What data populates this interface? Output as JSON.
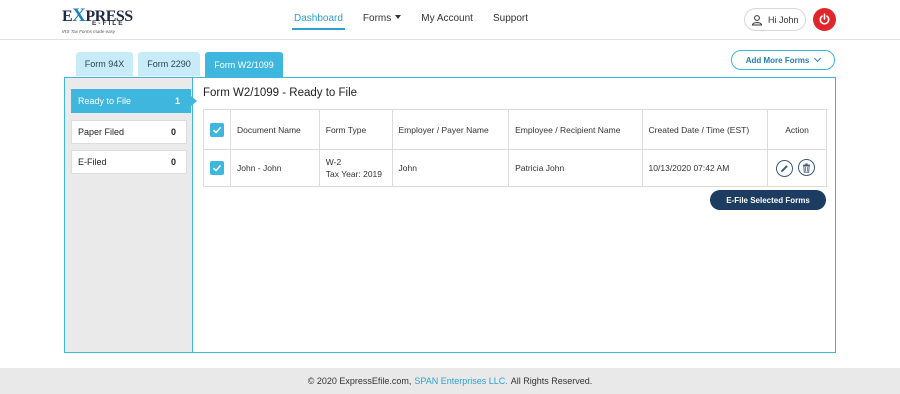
{
  "brand": {
    "logo_main_a": "E",
    "logo_main_x": "X",
    "logo_main_b": "PRESS",
    "logo_sub": "E-FILE",
    "logo_tag": "IRS Tax Forms made easy"
  },
  "nav": {
    "items": [
      {
        "label": "Dashboard",
        "active": true
      },
      {
        "label": "Forms",
        "active": false
      },
      {
        "label": "My Account",
        "active": false
      },
      {
        "label": "Support",
        "active": false
      }
    ]
  },
  "user": {
    "greeting": "Hi John"
  },
  "tabs": [
    {
      "label": "Form 94X",
      "active": false
    },
    {
      "label": "Form 2290",
      "active": false
    },
    {
      "label": "Form W2/1099",
      "active": true
    }
  ],
  "add_forms_label": "Add More Forms",
  "sidebar": {
    "items": [
      {
        "label": "Ready to File",
        "count": "1",
        "active": true
      },
      {
        "label": "Paper Filed",
        "count": "0",
        "active": false
      },
      {
        "label": "E-Filed",
        "count": "0",
        "active": false
      }
    ]
  },
  "content": {
    "title": "Form W2/1099 - Ready to File"
  },
  "table": {
    "headers": [
      "Document Name",
      "Form Type",
      "Employer / Payer Name",
      "Employee / Recipient Name",
      "Created Date / Time (EST)",
      "Action"
    ],
    "rows": [
      {
        "document_name": "John - John",
        "form_type_line1": "W-2",
        "form_type_line2": "Tax Year: 2019",
        "employer": "John",
        "employee": "Patricia John",
        "created": "10/13/2020 07:42 AM",
        "checked": true
      }
    ]
  },
  "efile_button_label": "E-File Selected Forms",
  "footer": {
    "prefix": "© 2020 ExpressEfile.com,",
    "link": "SPAN Enterprises LLC.",
    "suffix": "All Rights Reserved."
  },
  "colors": {
    "accent": "#3fb6de",
    "nav_active": "#2e9fd0",
    "dark_button": "#1d3c61",
    "power": "#e0262a"
  }
}
